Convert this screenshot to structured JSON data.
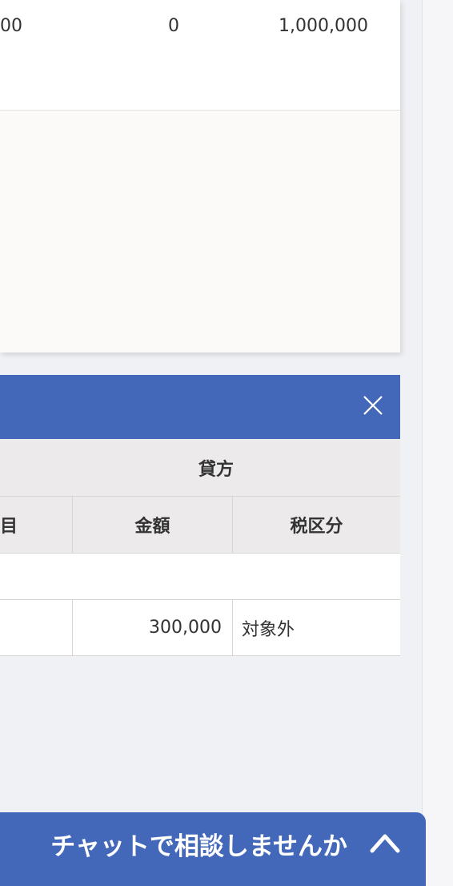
{
  "summary": {
    "row": [
      "00",
      "0",
      "1,000,000"
    ]
  },
  "journal_panel": {
    "close_icon": "close-icon",
    "credit_header": "貸方",
    "columns": {
      "account_partial": "目",
      "amount": "金額",
      "tax_category": "税区分"
    },
    "rows": [
      {
        "amount": "300,000",
        "tax_category": "対象外"
      }
    ]
  },
  "chat": {
    "label": "チャットで相談しませんか",
    "chevron_icon": "chevron-up-icon"
  },
  "colors": {
    "accent": "#4468b9",
    "header_bg": "#eceaea",
    "page_bg": "#f0f1f5"
  }
}
